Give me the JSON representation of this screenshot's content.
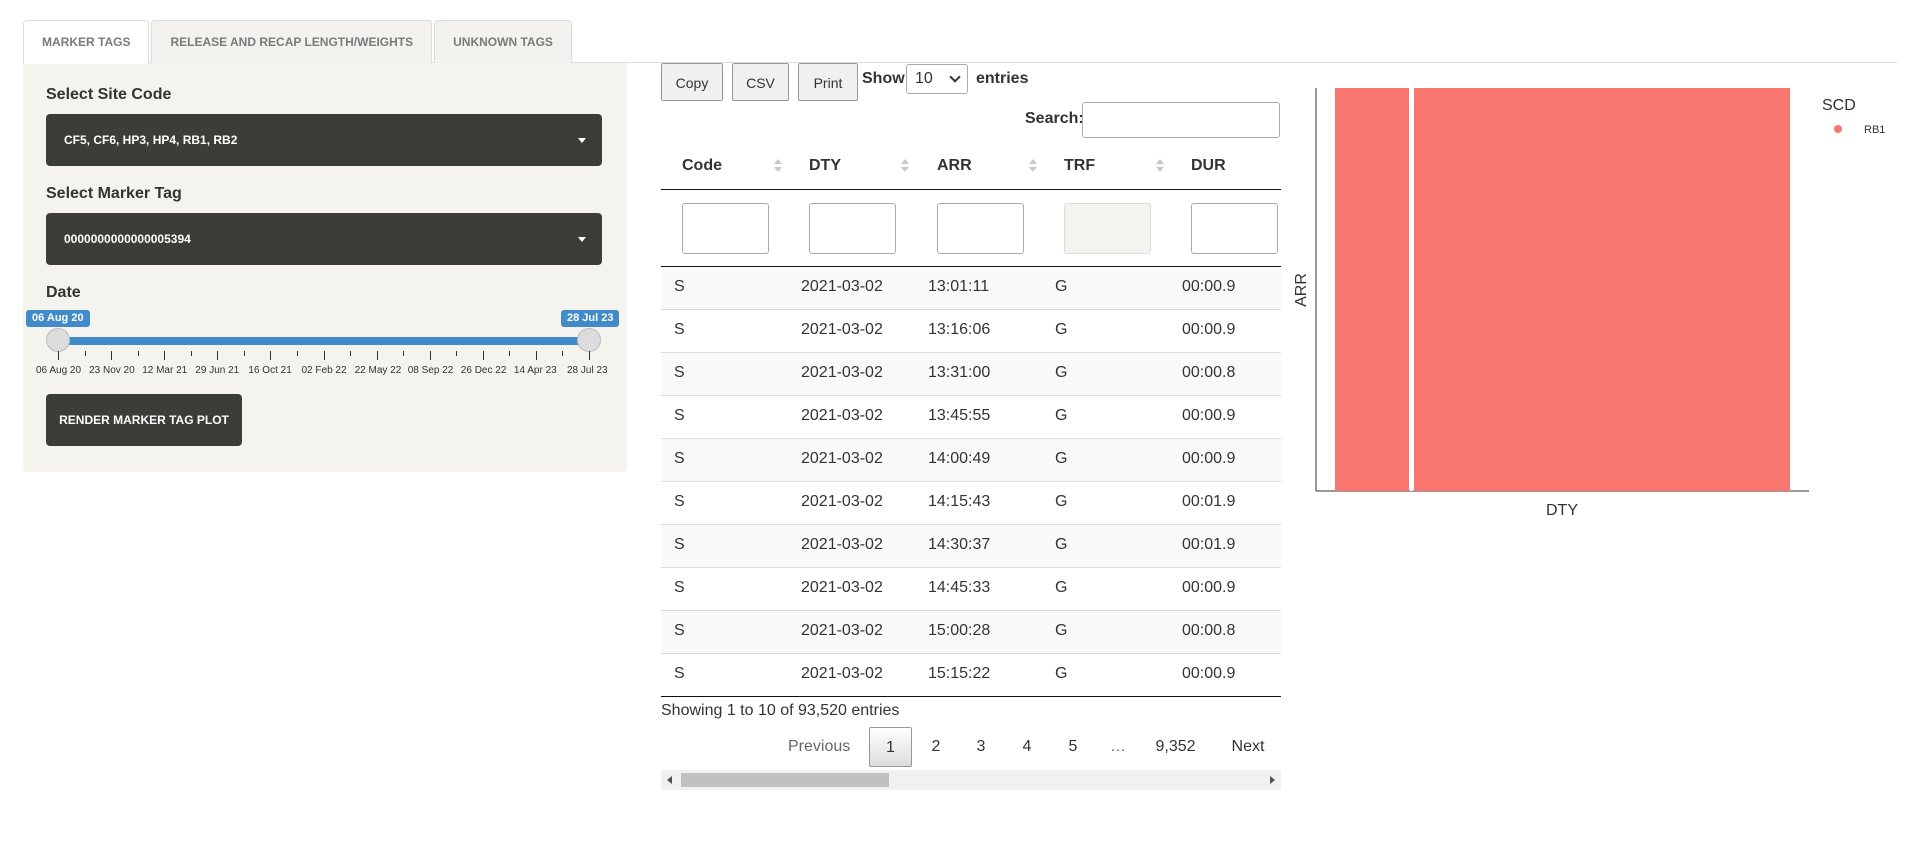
{
  "tabs": [
    "MARKER TAGS",
    "RELEASE AND RECAP LENGTH/WEIGHTS",
    "UNKNOWN TAGS"
  ],
  "sidebar": {
    "site_label": "Select Site Code",
    "site_value": "CF5, CF6, HP3, HP4, RB1, RB2",
    "marker_label": "Select Marker Tag",
    "marker_value": "0000000000000005394",
    "date_label": "Date",
    "date_from": "06 Aug 20",
    "date_to": "28 Jul 23",
    "date_ticks": [
      "06 Aug 20",
      "23 Nov 20",
      "12 Mar 21",
      "29 Jun 21",
      "16 Oct 21",
      "02 Feb 22",
      "22 May 22",
      "08 Sep 22",
      "26 Dec 22",
      "14 Apr 23",
      "28 Jul 23"
    ],
    "render_button": "RENDER MARKER TAG PLOT"
  },
  "toolbar": {
    "copy": "Copy",
    "csv": "CSV",
    "print": "Print",
    "show": "Show",
    "length_value": "10",
    "entries": "entries",
    "search_label": "Search:"
  },
  "table": {
    "columns": [
      "Code",
      "DTY",
      "ARR",
      "TRF",
      "DUR"
    ],
    "rows": [
      [
        "S",
        "2021-03-02",
        "13:01:11",
        "G",
        "00:00.9"
      ],
      [
        "S",
        "2021-03-02",
        "13:16:06",
        "G",
        "00:00.9"
      ],
      [
        "S",
        "2021-03-02",
        "13:31:00",
        "G",
        "00:00.8"
      ],
      [
        "S",
        "2021-03-02",
        "13:45:55",
        "G",
        "00:00.9"
      ],
      [
        "S",
        "2021-03-02",
        "14:00:49",
        "G",
        "00:00.9"
      ],
      [
        "S",
        "2021-03-02",
        "14:15:43",
        "G",
        "00:01.9"
      ],
      [
        "S",
        "2021-03-02",
        "14:30:37",
        "G",
        "00:01.9"
      ],
      [
        "S",
        "2021-03-02",
        "14:45:33",
        "G",
        "00:00.9"
      ],
      [
        "S",
        "2021-03-02",
        "15:00:28",
        "G",
        "00:00.8"
      ],
      [
        "S",
        "2021-03-02",
        "15:15:22",
        "G",
        "00:00.9"
      ]
    ],
    "info": "Showing 1 to 10 of 93,520 entries"
  },
  "pagination": {
    "previous": "Previous",
    "pages": [
      "1",
      "2",
      "3",
      "4",
      "5",
      "…",
      "9,352"
    ],
    "next": "Next"
  },
  "chart_data": {
    "type": "scatter",
    "xlabel": "DTY",
    "ylabel": "ARR",
    "legend_title": "SCD",
    "legend_placement": "right",
    "series": [
      {
        "name": "RB1",
        "color": "#f8766d"
      }
    ],
    "grid": false
  }
}
